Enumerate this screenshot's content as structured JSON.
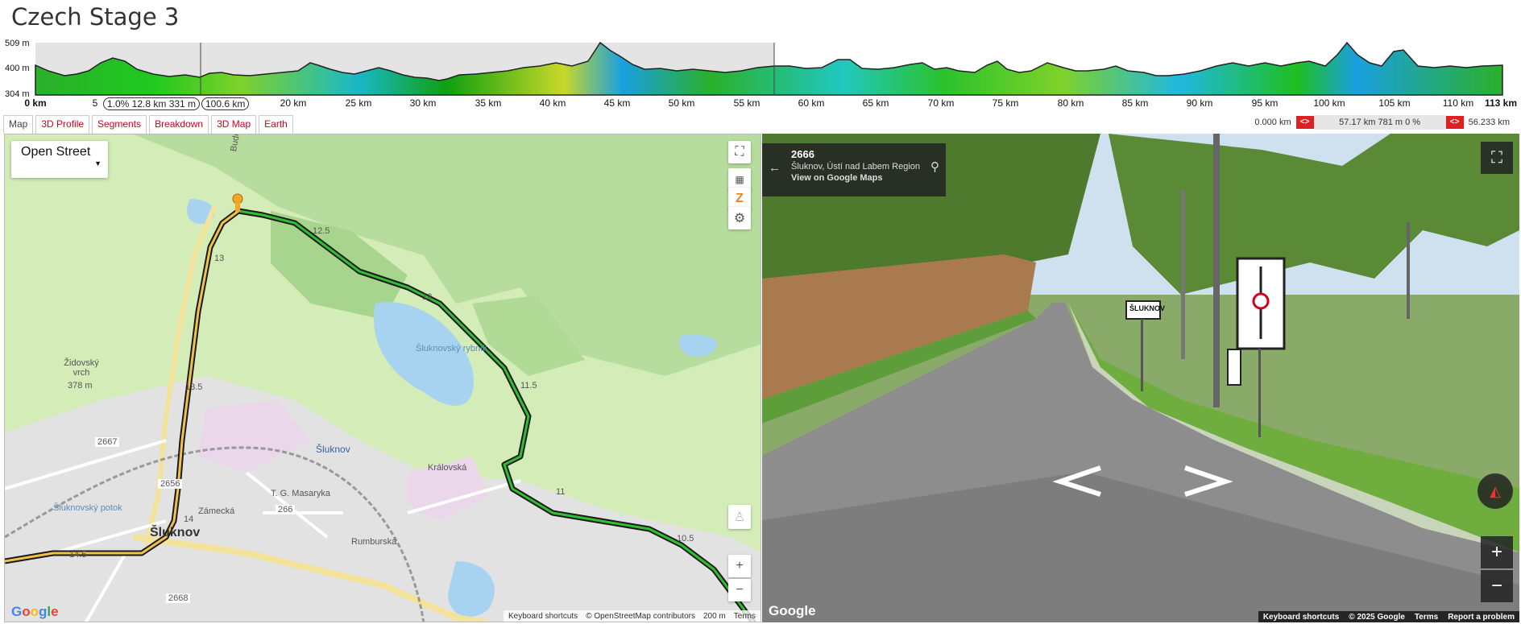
{
  "title": "Czech Stage 3",
  "profile": {
    "y_labels": [
      "509 m",
      "400 m",
      "304 m"
    ],
    "x_labels": [
      "0 km",
      "5",
      "20 km",
      "25 km",
      "30 km",
      "35 km",
      "40 km",
      "45 km",
      "50 km",
      "55 km",
      "60 km",
      "65 km",
      "70 km",
      "75 km",
      "80 km",
      "85 km",
      "90 km",
      "95 km",
      "100 km",
      "105 km",
      "110 km",
      "113 km"
    ],
    "selection_info": "1.0% 12.8 km 331 m",
    "cursor_distance": "100.6 km"
  },
  "tabs": [
    "Map",
    "3D Profile",
    "Segments",
    "Breakdown",
    "3D Map",
    "Earth"
  ],
  "range": {
    "start": "0.000 km",
    "middle": "57.17 km 781 m 0 %",
    "end": "56.233 km",
    "arrow": "<>"
  },
  "map": {
    "type_label": "Open Street",
    "labels": {
      "zidovsky": "Židovský vrch",
      "elev": "378 m",
      "rybnik": "Šluknovský rybník",
      "potok": "Šluknovský potok",
      "kralovska": "Královská",
      "zamecka": "Zámecká",
      "rumburska": "Rumburská",
      "masaryka": "T. G. Masaryka",
      "budisinska": "Budišínská",
      "town_small": "Šluknov",
      "town_large": "Šluknov"
    },
    "route_markers": [
      "12.5",
      "12",
      "11.5",
      "11",
      "10.5",
      "13",
      "13.5",
      "14",
      "14.5"
    ],
    "road_numbers": [
      "2667",
      "2656",
      "266",
      "2668"
    ],
    "footer": {
      "shortcuts": "Keyboard shortcuts",
      "attribution": "© OpenStreetMap contributors",
      "scale": "200 m",
      "terms": "Terms"
    },
    "logo": "Google"
  },
  "streetview": {
    "road_number": "2666",
    "address": "Šluknov, Ústí nad Labem Region",
    "link": "View on Google Maps",
    "sign_text": "ŠLUKNOV",
    "footer": {
      "shortcuts": "Keyboard shortcuts",
      "copyright": "© 2025 Google",
      "terms": "Terms",
      "report": "Report a problem"
    },
    "logo": "Google"
  },
  "colors": {
    "accent": "#d0021b",
    "route": "#1a7a1a"
  }
}
